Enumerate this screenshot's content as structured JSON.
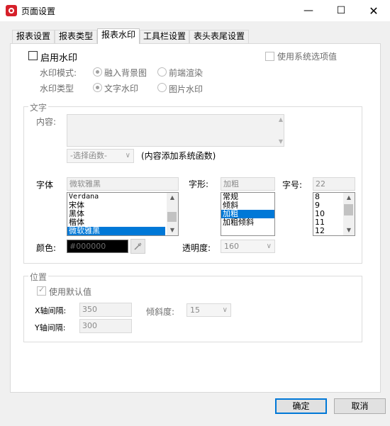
{
  "window": {
    "title": "页面设置"
  },
  "tabs": [
    {
      "label": "报表设置"
    },
    {
      "label": "报表类型"
    },
    {
      "label": "报表水印"
    },
    {
      "label": "工具栏设置"
    },
    {
      "label": "表头表尾设置"
    }
  ],
  "watermark": {
    "enable_label": "启用水印",
    "use_system_label": "使用系统选项值",
    "mode_label": "水印模式:",
    "mode_options": [
      "融入背景图",
      "前端渲染"
    ],
    "type_label": "水印类型",
    "type_options": [
      "文字水印",
      "图片水印"
    ]
  },
  "text_group": {
    "title": "文字",
    "content_label": "内容:",
    "function_combo": "-选择函数-",
    "function_hint": "(内容添加系统函数)",
    "font_label": "字体",
    "font_value": "微软雅黑",
    "font_list": [
      "Verdana",
      "宋体",
      "黑体",
      "楷体",
      "微软雅黑"
    ],
    "style_label": "字形:",
    "style_value": "加粗",
    "style_list": [
      "常规",
      "倾斜",
      "加粗",
      "加粗倾斜"
    ],
    "size_label": "字号:",
    "size_value": "22",
    "size_list": [
      "8",
      "9",
      "10",
      "11",
      "12"
    ],
    "color_label": "颜色:",
    "color_value": "#000000",
    "opacity_label": "透明度:",
    "opacity_value": "160"
  },
  "position_group": {
    "title": "位置",
    "use_default_label": "使用默认值",
    "x_label": "X轴间隔:",
    "x_value": "350",
    "y_label": "Y轴间隔:",
    "y_value": "300",
    "tilt_label": "倾斜度:",
    "tilt_value": "15"
  },
  "buttons": {
    "ok": "确定",
    "cancel": "取消"
  },
  "colors": {
    "accent": "#0078d7",
    "brand": "#d6202a"
  }
}
